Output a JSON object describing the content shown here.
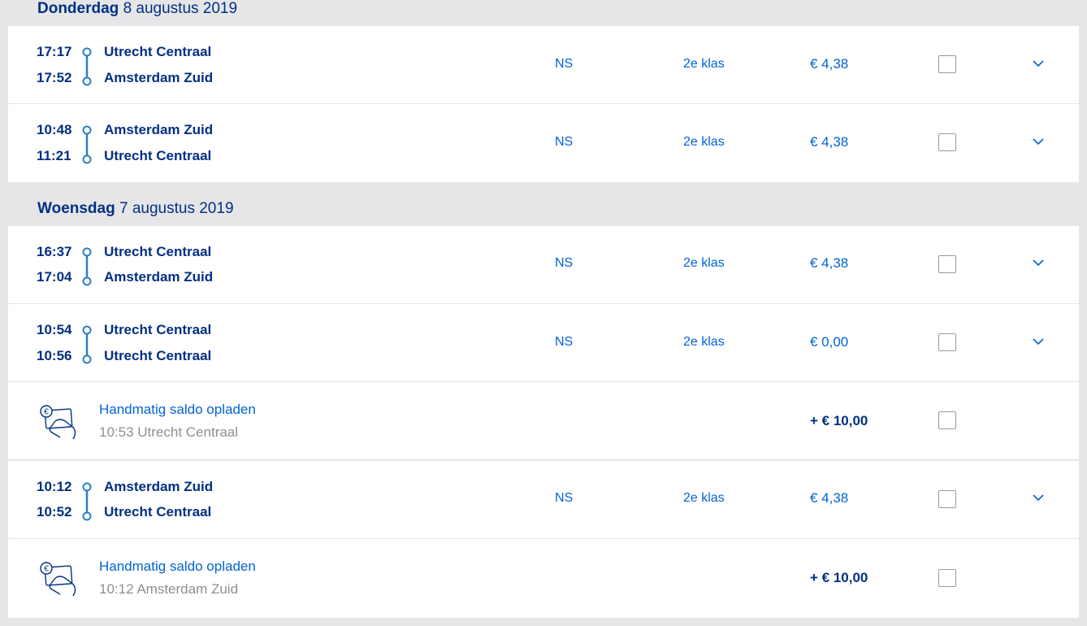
{
  "colors": {
    "background": "#e6e6e9",
    "card": "#ffffff",
    "dark_blue": "#003082",
    "link_blue": "#0063d3",
    "route_blue": "#2a7fbf",
    "muted": "#8f8f8f"
  },
  "days": [
    {
      "weekday": "Donderdag",
      "date": "8 augustus 2019",
      "rows": [
        {
          "type": "trip",
          "dep_time": "17:17",
          "arr_time": "17:52",
          "from": "Utrecht Centraal",
          "to": "Amsterdam Zuid",
          "carrier": "NS",
          "class": "2e klas",
          "price": "€ 4,38",
          "checked": false
        },
        {
          "type": "trip",
          "dep_time": "10:48",
          "arr_time": "11:21",
          "from": "Amsterdam Zuid",
          "to": "Utrecht Centraal",
          "carrier": "NS",
          "class": "2e klas",
          "price": "€ 4,38",
          "checked": false
        }
      ]
    },
    {
      "weekday": "Woensdag",
      "date": "7 augustus 2019",
      "rows": [
        {
          "type": "trip",
          "dep_time": "16:37",
          "arr_time": "17:04",
          "from": "Utrecht Centraal",
          "to": "Amsterdam Zuid",
          "carrier": "NS",
          "class": "2e klas",
          "price": "€ 4,38",
          "checked": false
        },
        {
          "type": "trip",
          "dep_time": "10:54",
          "arr_time": "10:56",
          "from": "Utrecht Centraal",
          "to": "Utrecht Centraal",
          "carrier": "NS",
          "class": "2e klas",
          "price": "€ 0,00",
          "checked": false
        },
        {
          "type": "topup",
          "title": "Handmatig saldo opladen",
          "detail": "10:53 Utrecht Centraal",
          "amount": "+ € 10,00",
          "icon": "card-topup-icon",
          "checked": false
        },
        {
          "type": "trip",
          "dep_time": "10:12",
          "arr_time": "10:52",
          "from": "Amsterdam Zuid",
          "to": "Utrecht Centraal",
          "carrier": "NS",
          "class": "2e klas",
          "price": "€ 4,38",
          "checked": false
        },
        {
          "type": "topup",
          "title": "Handmatig saldo opladen",
          "detail": "10:12 Amsterdam Zuid",
          "amount": "+ € 10,00",
          "icon": "card-topup-icon",
          "checked": false
        }
      ]
    }
  ]
}
